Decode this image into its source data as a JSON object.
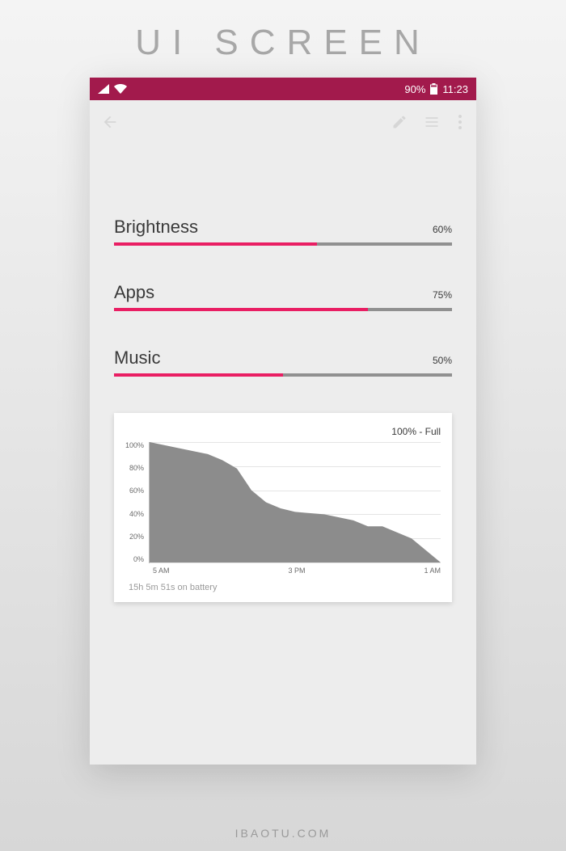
{
  "page_heading": "UI SCREEN",
  "footer_url": "IBAOTU.COM",
  "statusbar": {
    "battery_percent": "90%",
    "time": "11:23"
  },
  "sliders": [
    {
      "label": "Brightness",
      "value_text": "60%",
      "percent": 60
    },
    {
      "label": "Apps",
      "value_text": "75%",
      "percent": 75
    },
    {
      "label": "Music",
      "value_text": "50%",
      "percent": 50
    }
  ],
  "chart_card": {
    "header": "100% - Full",
    "footer": "15h 5m 51s on battery"
  },
  "chart_data": {
    "type": "area",
    "title": "",
    "xlabel": "",
    "ylabel": "",
    "y_ticks": [
      "100%",
      "80%",
      "60%",
      "40%",
      "20%",
      "0%"
    ],
    "x_ticks": [
      "5 AM",
      "3 PM",
      "1 AM"
    ],
    "ylim": [
      0,
      100
    ],
    "x": [
      0,
      2,
      4,
      5,
      6,
      7,
      8,
      9,
      10,
      12,
      14,
      15,
      16,
      17,
      18,
      19,
      20
    ],
    "values": [
      100,
      95,
      90,
      85,
      78,
      60,
      50,
      45,
      42,
      40,
      35,
      30,
      30,
      25,
      20,
      10,
      0
    ]
  }
}
